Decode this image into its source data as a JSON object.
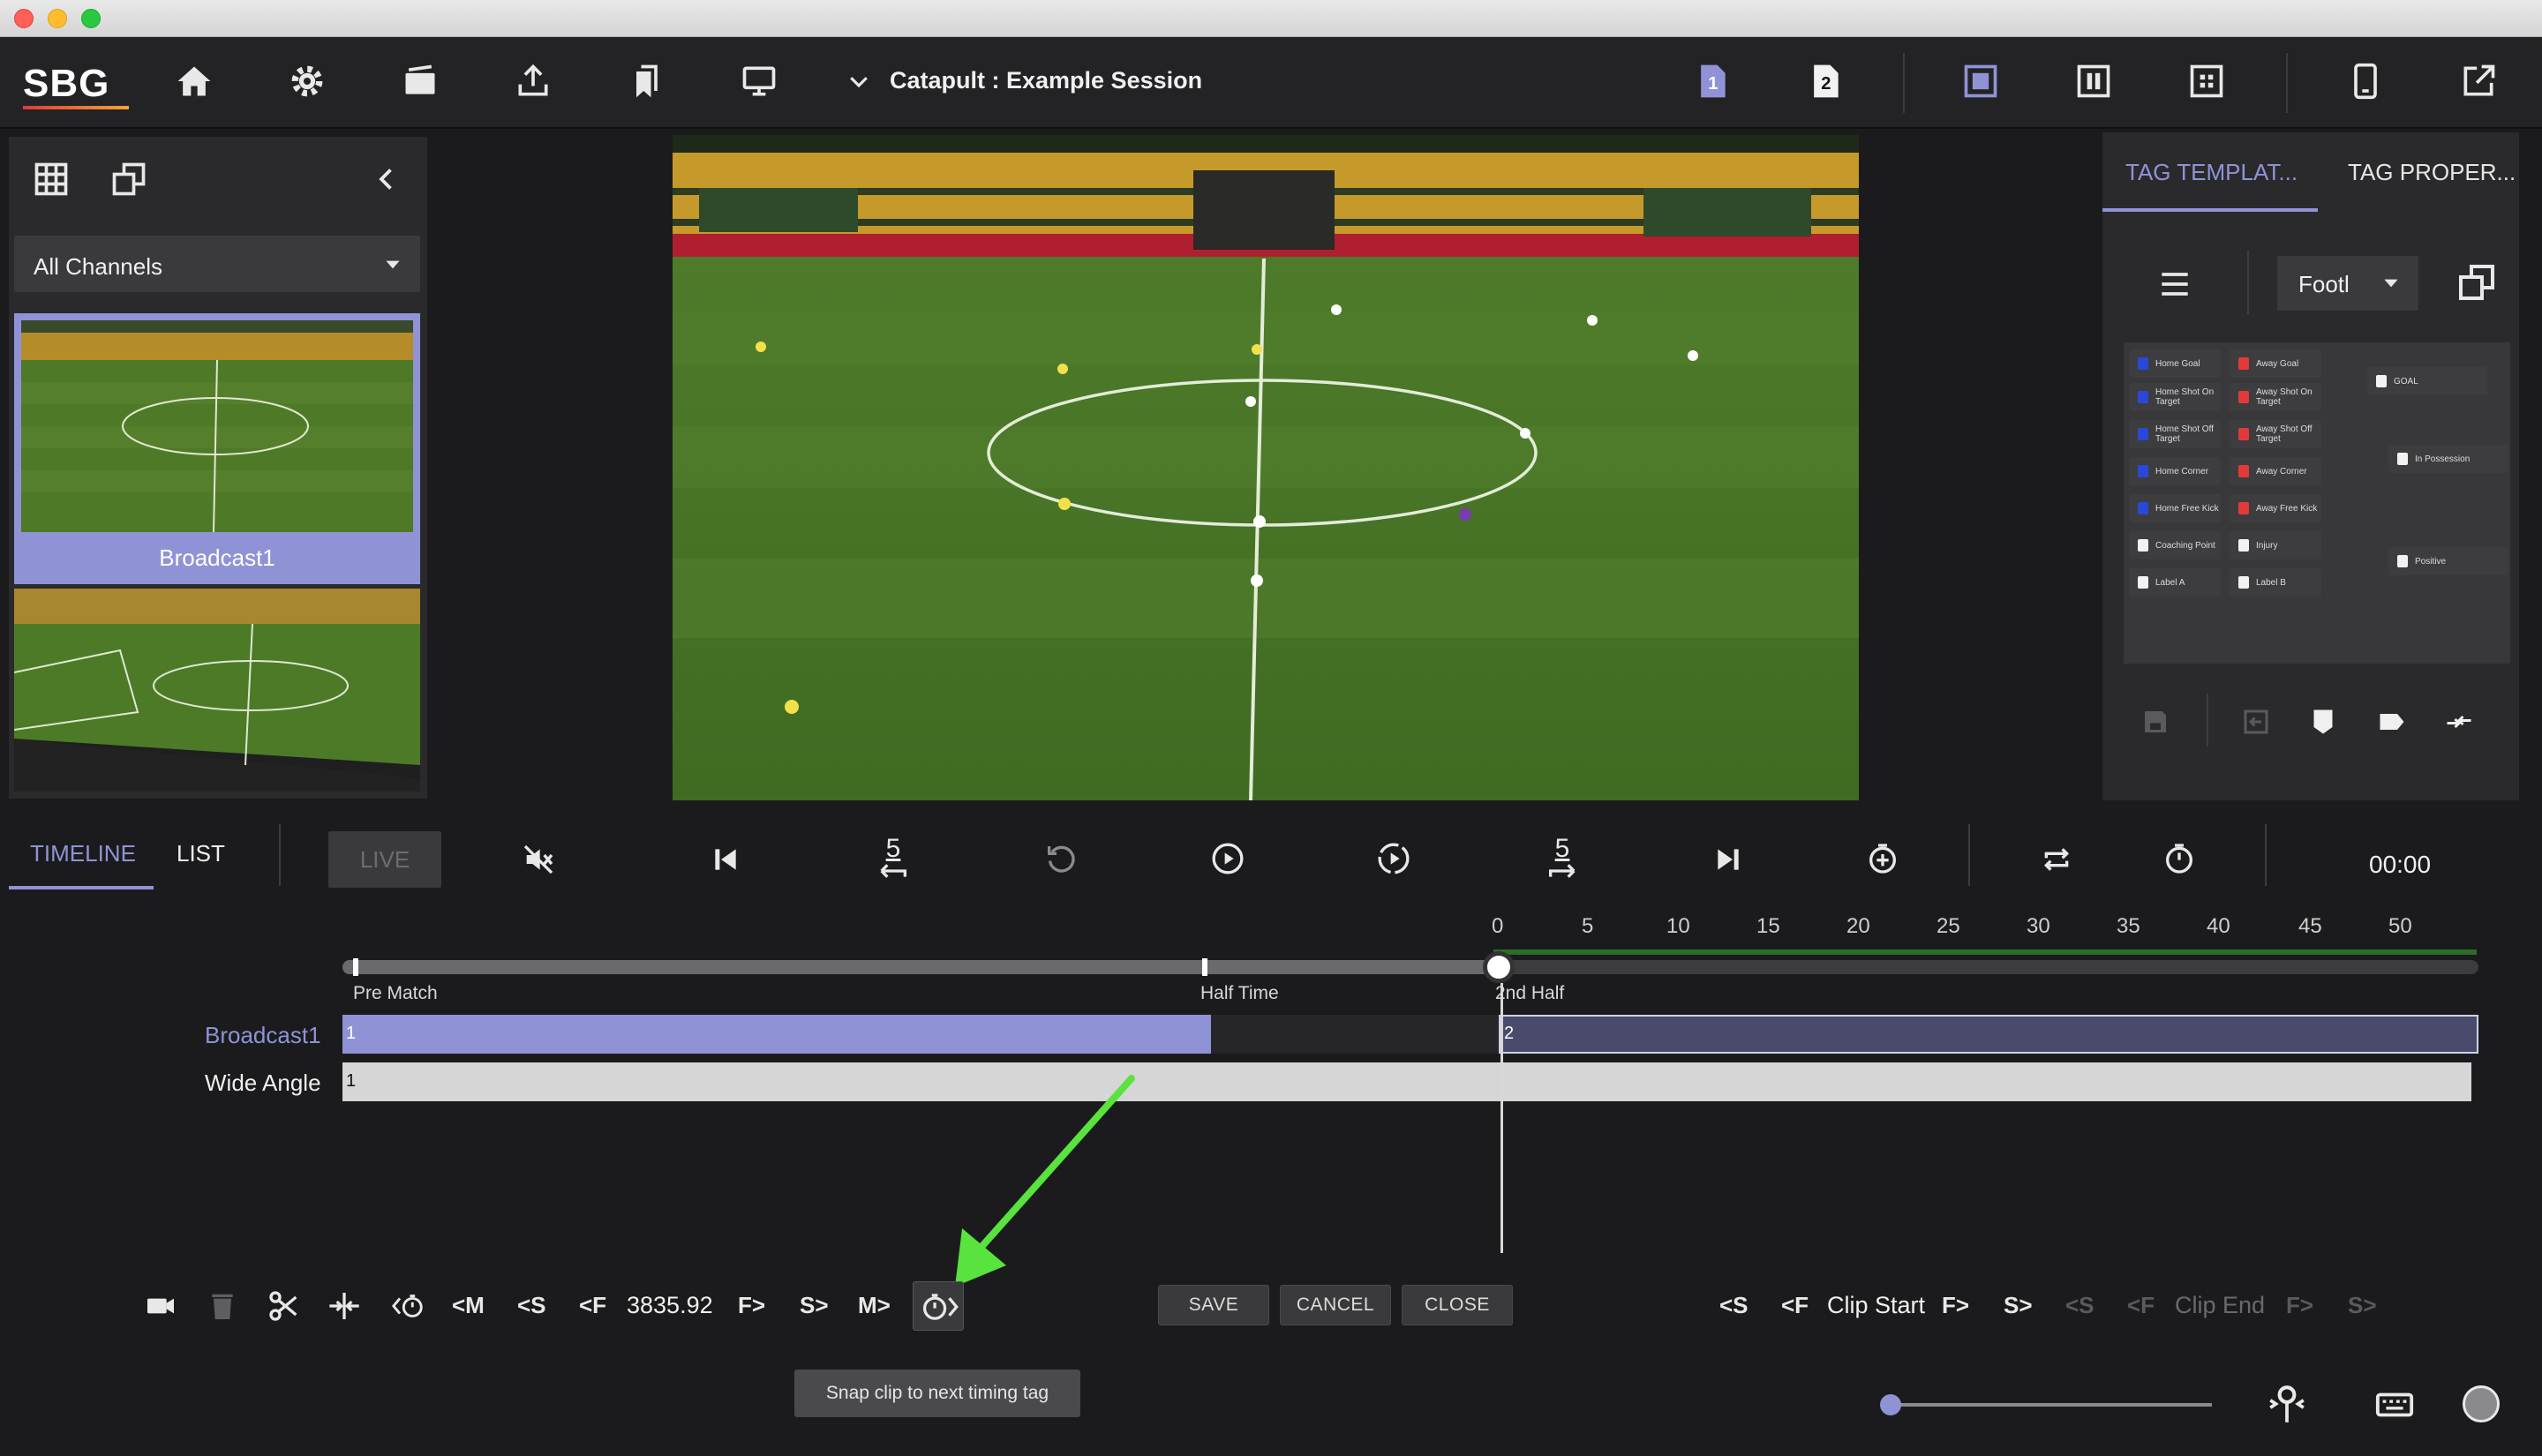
{
  "app": {
    "session_title": "Catapult : Example Session",
    "logo": "SBG",
    "colors": {
      "accent": "#8f93d6",
      "bg": "#1b1b1d",
      "panel": "#2a2a2c",
      "arrow": "#58e33e"
    }
  },
  "topbar": {
    "icons": [
      "home-icon",
      "gear-icon",
      "camera-icon",
      "upload-icon",
      "bookmarks-icon",
      "monitor-icon"
    ],
    "page_tabs": [
      "1",
      "2"
    ]
  },
  "left_panel": {
    "channel_select": "All Channels",
    "thumbnails": [
      {
        "label": "Broadcast1"
      },
      {
        "label": ""
      }
    ]
  },
  "right_panel": {
    "tabs": [
      "TAG TEMPLAT...",
      "TAG PROPER..."
    ],
    "template_select": "Footl",
    "tags_col1": [
      "Home Goal",
      "Home Shot On Target",
      "Home Shot Off Target",
      "Home Corner",
      "Home Free Kick",
      "Coaching Point",
      "Label A"
    ],
    "tags_col2": [
      "Away Goal",
      "Away Shot On Target",
      "Away Shot Off Target",
      "Away Corner",
      "Away Free Kick",
      "Injury",
      "Label B"
    ],
    "tags_col3": [
      "GOAL",
      "In Possession",
      "Positive"
    ]
  },
  "transport": {
    "tabs": [
      "TIMELINE",
      "LIST"
    ],
    "live_label": "LIVE",
    "skip_back_label": "5",
    "skip_fwd_label": "5",
    "time": "00:00"
  },
  "timeline": {
    "ruler_ticks": [
      "0",
      "5",
      "10",
      "15",
      "20",
      "25",
      "30",
      "35",
      "40",
      "45",
      "50"
    ],
    "periods": [
      "Pre Match",
      "Half Time",
      "2nd Half"
    ],
    "tracks": [
      {
        "label": "Broadcast1",
        "seg1": "1",
        "seg2": "2"
      },
      {
        "label": "Wide Angle",
        "seg1": "1"
      }
    ]
  },
  "clip_editor": {
    "left_labels": [
      "<M",
      "<S",
      "<F",
      "F>",
      "S>",
      "M>"
    ],
    "time_value": "3835.92",
    "save_label": "SAVE",
    "cancel_label": "CANCEL",
    "close_label": "CLOSE",
    "clip_start_label": "Clip Start",
    "clip_end_label": "Clip End",
    "start_nav": [
      "<S",
      "<F",
      "F>",
      "S>"
    ],
    "end_nav": [
      "<S",
      "<F",
      "F>",
      "S>"
    ],
    "tooltip": "Snap clip to next timing tag"
  }
}
